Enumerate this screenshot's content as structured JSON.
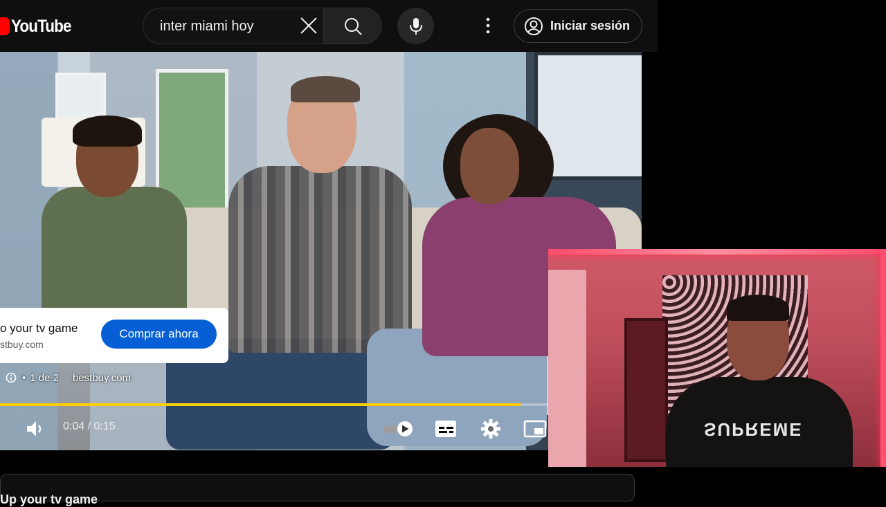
{
  "header": {
    "logo_text": "YouTube",
    "search_value": "inter miami hoy",
    "signin_label": "Iniciar sesión"
  },
  "ad": {
    "title": "o your tv game",
    "domain": "stbuy.com",
    "cta_label": "Comprar ahora",
    "sequence": "1 de 2",
    "site": "bestbuy.com"
  },
  "player": {
    "time": "0:04 / 0:15",
    "progress_fraction": 0.266
  },
  "below": {
    "title": "Up your tv game"
  },
  "webcam": {
    "shirt_text": "SUPREME"
  },
  "colors": {
    "brand_red": "#ff0000",
    "cta_blue": "#065fd4",
    "ad_progress": "#ffcc00",
    "background": "#0f0f0f"
  }
}
